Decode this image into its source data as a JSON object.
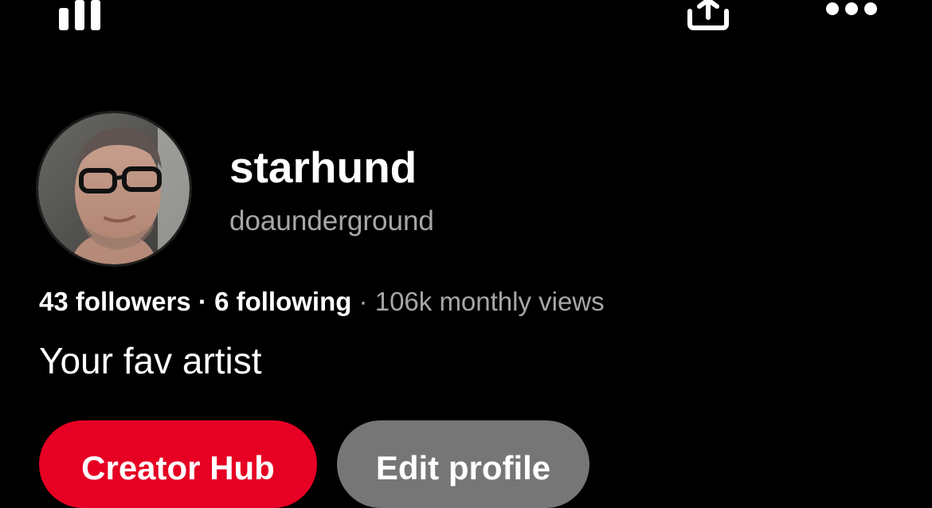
{
  "header": {
    "stats_icon": "bar-chart-icon",
    "share_icon": "share-upload-icon",
    "more_icon": "more-horizontal-icon"
  },
  "profile": {
    "display_name": "starhund",
    "username": "doaunderground",
    "followers": "43 followers",
    "separator_1": " · ",
    "following": "6 following",
    "separator_2": " · ",
    "monthly_views": "106k monthly views",
    "bio": "Your fav artist"
  },
  "actions": {
    "primary_label": "Creator Hub",
    "secondary_label": "Edit profile"
  },
  "colors": {
    "background": "#000000",
    "text": "#ffffff",
    "muted_text": "#a7a7a7",
    "primary_button": "#e60023",
    "secondary_button": "#767676"
  }
}
